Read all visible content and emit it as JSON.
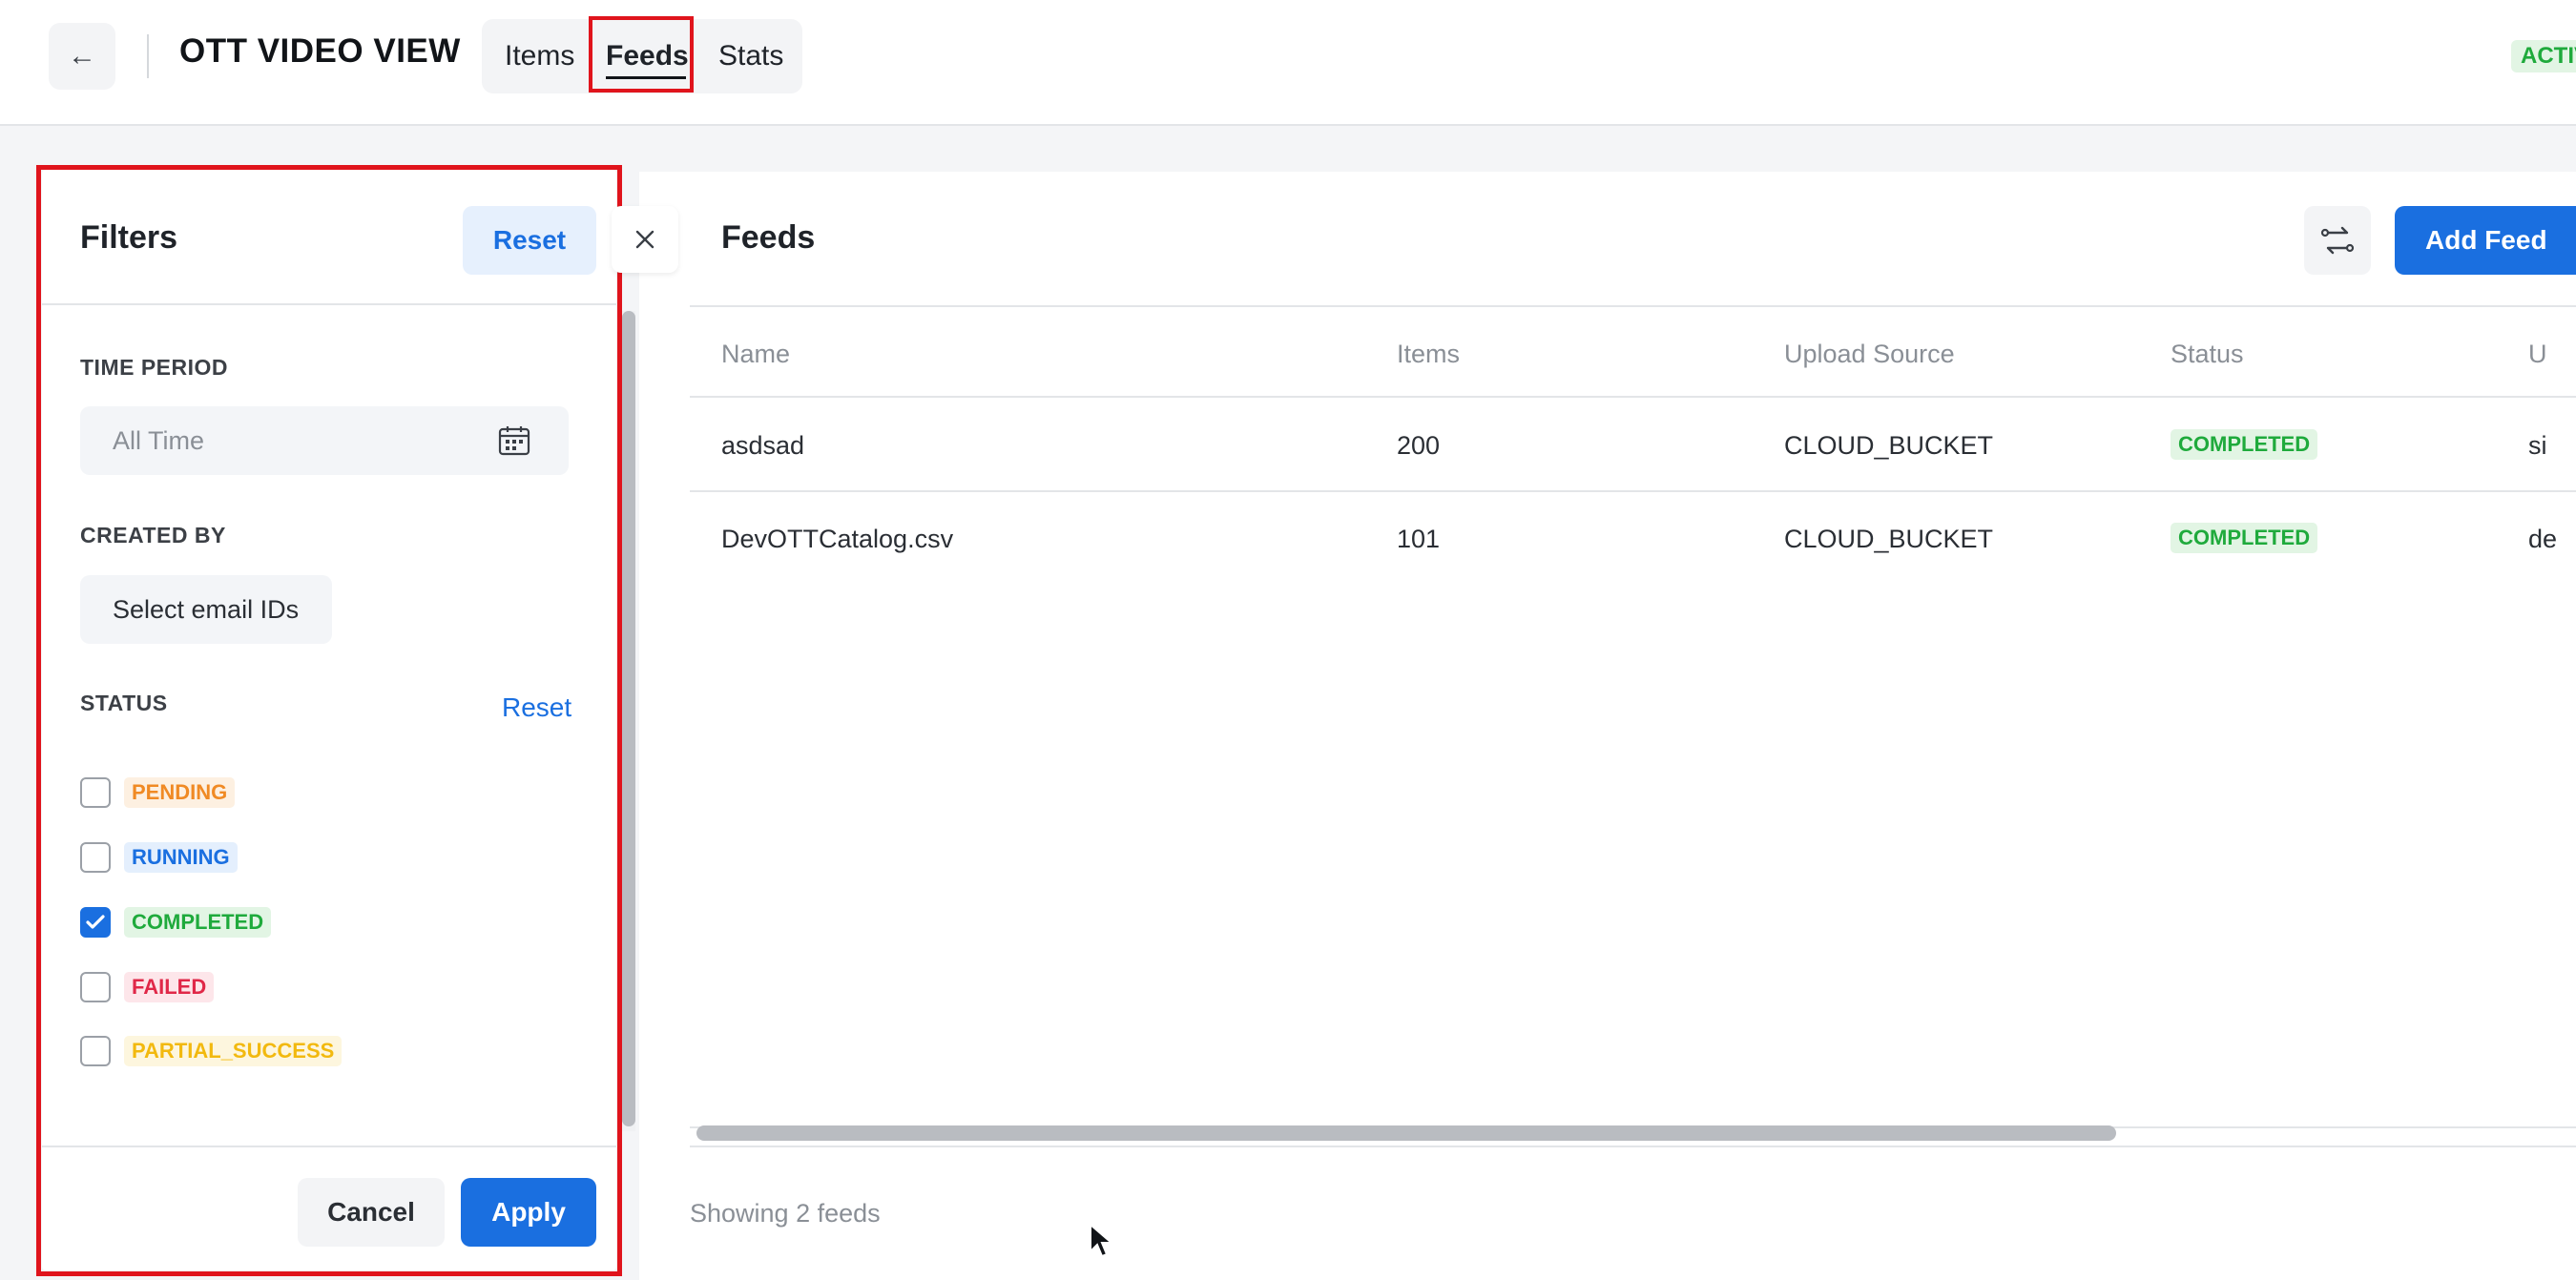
{
  "header": {
    "back_icon": "arrow-left-icon",
    "back_glyph": "←",
    "title": "OTT VIDEO VIEW",
    "tabs": [
      {
        "label": "Items",
        "active": false
      },
      {
        "label": "Feeds",
        "active": true
      },
      {
        "label": "Stats",
        "active": false
      }
    ],
    "status_badge": "ACTIVE"
  },
  "filters": {
    "title": "Filters",
    "reset_label": "Reset",
    "time_period": {
      "label": "TIME PERIOD",
      "placeholder": "All Time",
      "icon": "calendar-icon"
    },
    "created_by": {
      "label": "CREATED BY",
      "placeholder": "Select email IDs"
    },
    "status": {
      "label": "STATUS",
      "reset_label": "Reset",
      "options": [
        {
          "label": "PENDING",
          "checked": false,
          "color": "#f08a24"
        },
        {
          "label": "RUNNING",
          "checked": false,
          "color": "#1a6fe0"
        },
        {
          "label": "COMPLETED",
          "checked": true,
          "color": "#1faa3c"
        },
        {
          "label": "FAILED",
          "checked": false,
          "color": "#e02848"
        },
        {
          "label": "PARTIAL_SUCCESS",
          "checked": false,
          "color": "#f2b90f"
        }
      ]
    },
    "cancel_label": "Cancel",
    "apply_label": "Apply"
  },
  "feeds": {
    "title": "Feeds",
    "sync_icon": "sync-icon",
    "add_label": "Add Feed",
    "columns": [
      "Name",
      "Items",
      "Upload Source",
      "Status",
      "U"
    ],
    "rows": [
      {
        "name": "asdsad",
        "items": "200",
        "source": "CLOUD_BUCKET",
        "status": "COMPLETED",
        "uploaded": "si"
      },
      {
        "name": "DevOTTCatalog.csv",
        "items": "101",
        "source": "CLOUD_BUCKET",
        "status": "COMPLETED",
        "uploaded": "de"
      }
    ],
    "footer": "Showing 2 feeds"
  },
  "colors": {
    "accent": "#1a6fe0",
    "highlight": "#e0141c"
  }
}
